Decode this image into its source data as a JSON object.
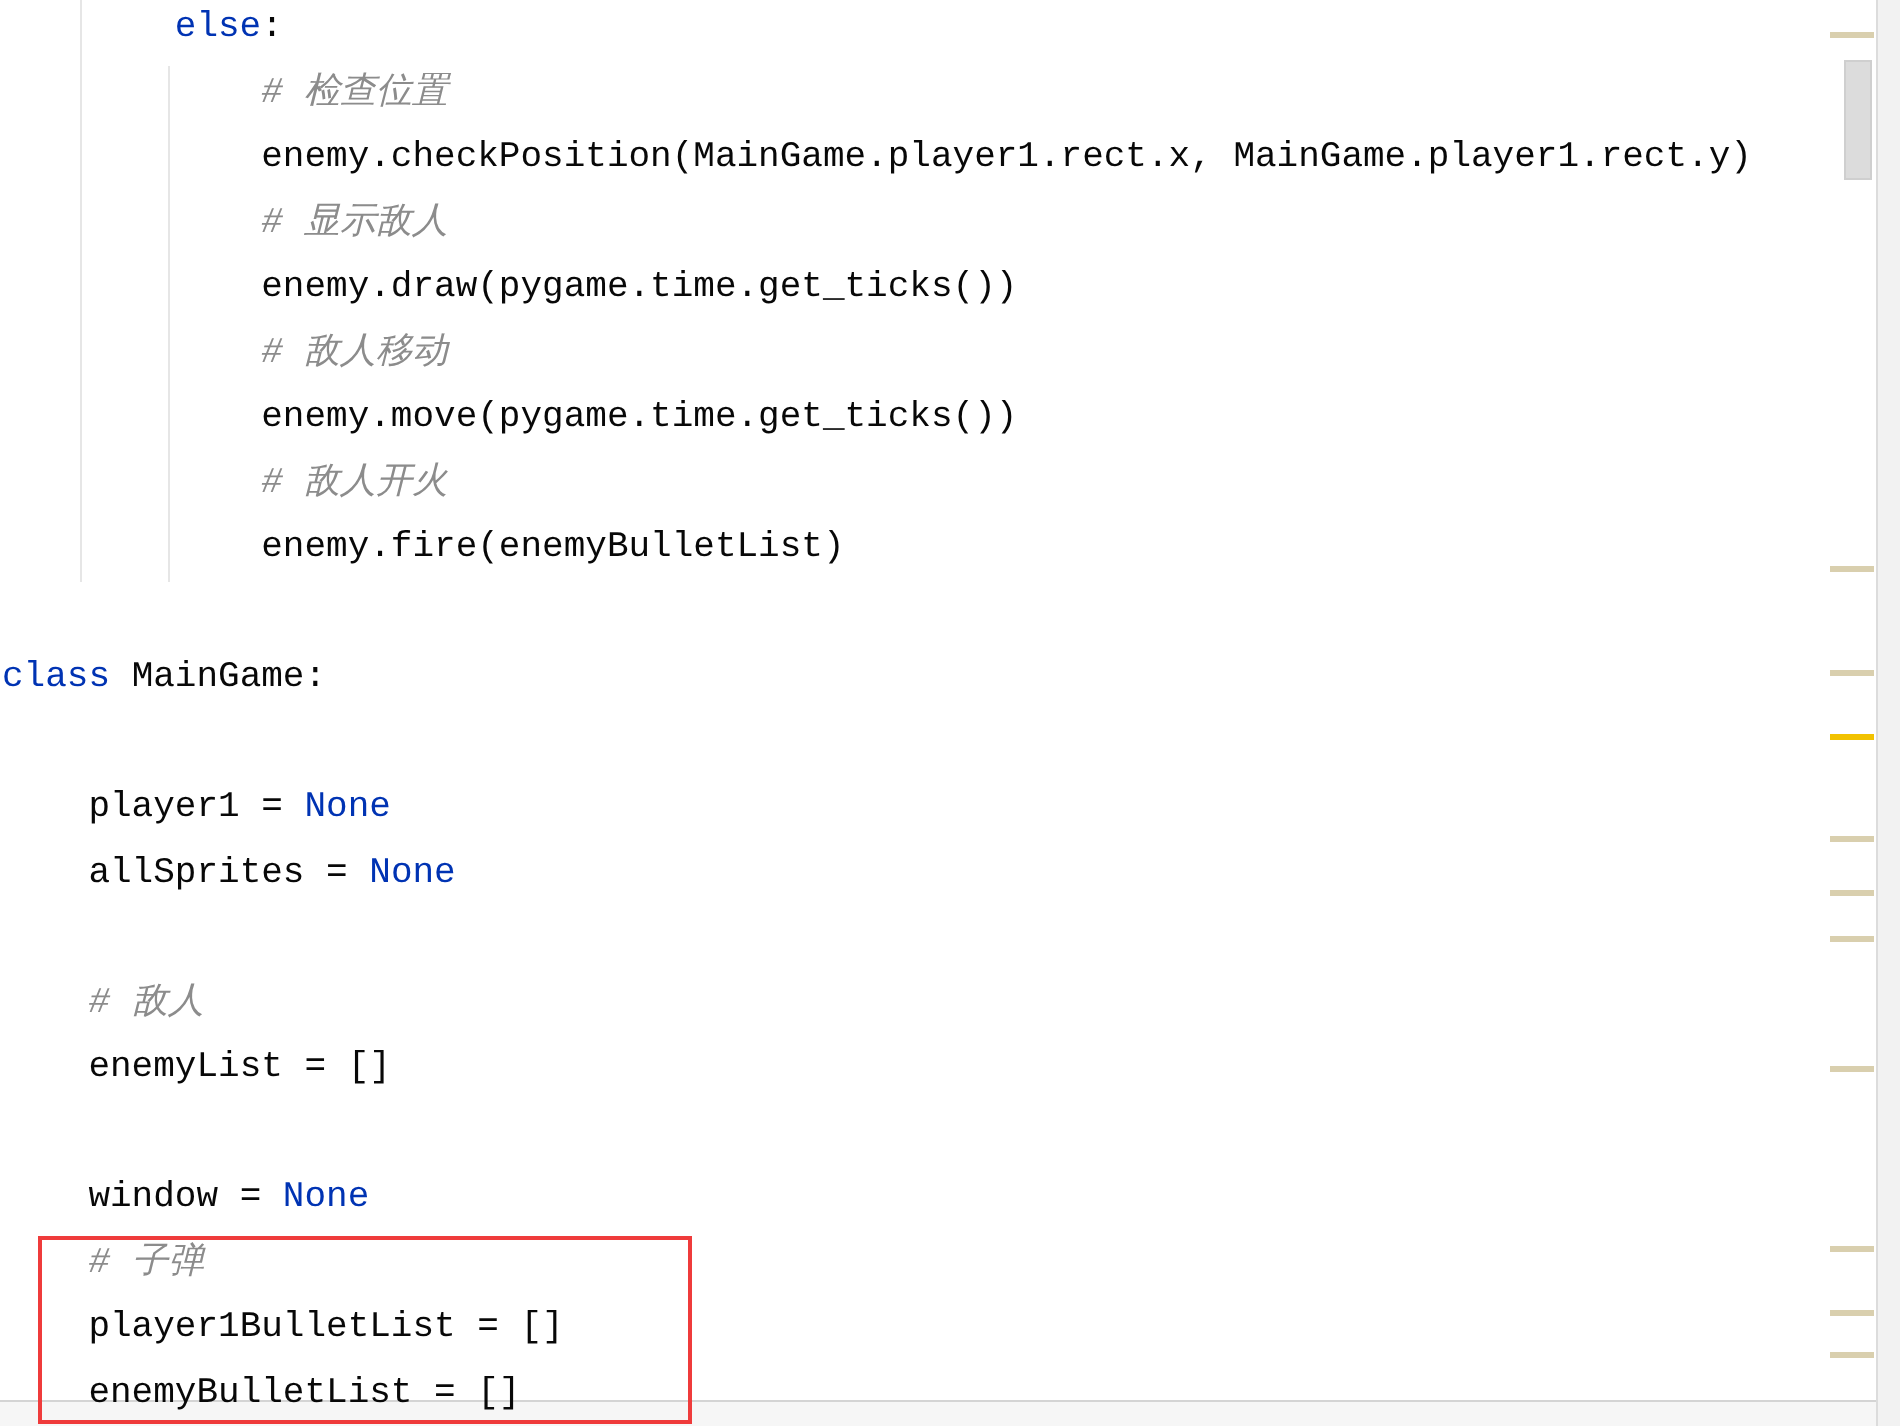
{
  "editor": {
    "lines": [
      {
        "kind": "scope",
        "children": [
          {
            "kind": "scope",
            "children": [
              {
                "kind": "code",
                "tokens": [
                  {
                    "kind": "keyword",
                    "text": "else"
                  },
                  {
                    "kind": "plain",
                    "text": ":"
                  }
                ],
                "children": [
                  {
                    "kind": "code",
                    "tokens": [
                      {
                        "kind": "comment",
                        "text": "# 检查位置"
                      }
                    ]
                  },
                  {
                    "kind": "code",
                    "tokens": [
                      {
                        "kind": "plain",
                        "text": "enemy.checkPosition(MainGame.player1.rect.x, MainGame.player1.rect.y)"
                      }
                    ]
                  },
                  {
                    "kind": "code",
                    "tokens": [
                      {
                        "kind": "comment",
                        "text": "# 显示敌人"
                      }
                    ]
                  },
                  {
                    "kind": "code",
                    "tokens": [
                      {
                        "kind": "plain",
                        "text": "enemy.draw(pygame.time.get_ticks())"
                      }
                    ]
                  },
                  {
                    "kind": "code",
                    "tokens": [
                      {
                        "kind": "comment",
                        "text": "# 敌人移动"
                      }
                    ]
                  },
                  {
                    "kind": "code",
                    "tokens": [
                      {
                        "kind": "plain",
                        "text": "enemy.move(pygame.time.get_ticks())"
                      }
                    ]
                  },
                  {
                    "kind": "code",
                    "tokens": [
                      {
                        "kind": "comment",
                        "text": "# 敌人开火"
                      }
                    ]
                  },
                  {
                    "kind": "code",
                    "tokens": [
                      {
                        "kind": "plain",
                        "text": "enemy.fire(enemyBulletList)"
                      }
                    ]
                  }
                ]
              }
            ]
          }
        ]
      },
      {
        "kind": "blank"
      },
      {
        "kind": "code",
        "tokens": [
          {
            "kind": "keyword",
            "text": "class"
          },
          {
            "kind": "plain",
            "text": " MainGame:"
          }
        ],
        "children": [
          {
            "kind": "blank"
          },
          {
            "kind": "code",
            "tokens": [
              {
                "kind": "plain",
                "text": "player1 = "
              },
              {
                "kind": "keyword",
                "text": "None"
              }
            ]
          },
          {
            "kind": "code",
            "tokens": [
              {
                "kind": "plain",
                "text": "allSprites = "
              },
              {
                "kind": "keyword",
                "text": "None"
              }
            ]
          },
          {
            "kind": "blank"
          },
          {
            "kind": "code",
            "tokens": [
              {
                "kind": "comment",
                "text": "# 敌人"
              }
            ]
          },
          {
            "kind": "code",
            "tokens": [
              {
                "kind": "plain",
                "text": "enemyList = []"
              }
            ]
          },
          {
            "kind": "blank"
          },
          {
            "kind": "code",
            "tokens": [
              {
                "kind": "plain",
                "text": "window = "
              },
              {
                "kind": "keyword",
                "text": "None"
              }
            ]
          },
          {
            "kind": "code",
            "tokens": [
              {
                "kind": "comment",
                "text": "# 子弹"
              }
            ]
          },
          {
            "kind": "code",
            "tokens": [
              {
                "kind": "plain",
                "text": "player1BulletList = []"
              }
            ]
          },
          {
            "kind": "code",
            "tokens": [
              {
                "kind": "plain",
                "text": "enemyBulletList = []"
              }
            ]
          }
        ]
      }
    ]
  }
}
